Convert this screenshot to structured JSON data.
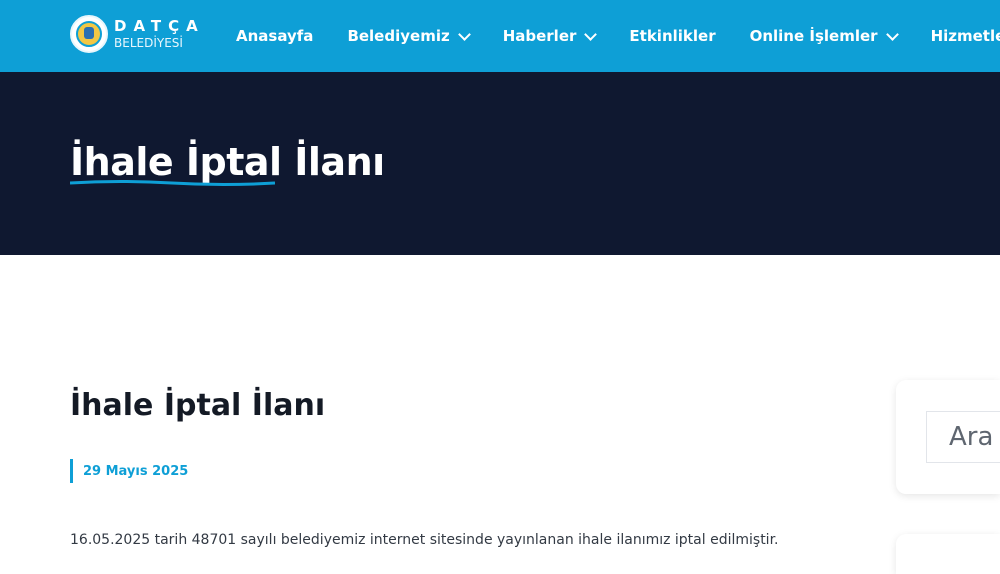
{
  "header": {
    "logo": {
      "title": "DATÇA",
      "subtitle": "BELEDİYESİ"
    },
    "nav": [
      {
        "label": "Anasayfa",
        "dropdown": false
      },
      {
        "label": "Belediyemiz",
        "dropdown": true
      },
      {
        "label": "Haberler",
        "dropdown": true
      },
      {
        "label": "Etkinlikler",
        "dropdown": false
      },
      {
        "label": "Online İşlemler",
        "dropdown": true
      },
      {
        "label": "Hizmetlerimiz",
        "dropdown": true
      }
    ],
    "colors": {
      "bar": "#0e9fd6"
    }
  },
  "hero": {
    "title": "İhale İptal İlanı",
    "colors": {
      "background": "#0f1830",
      "underline": "#0e9fd6"
    }
  },
  "article": {
    "title": "İhale İptal İlanı",
    "date": "29 Mayıs 2025",
    "body": "16.05.2025 tarih 48701 sayılı belediyemiz internet sitesinde yayınlanan ihale ilanımız iptal edilmiştir."
  },
  "sidebar": {
    "search": {
      "placeholder": "Ara"
    }
  }
}
